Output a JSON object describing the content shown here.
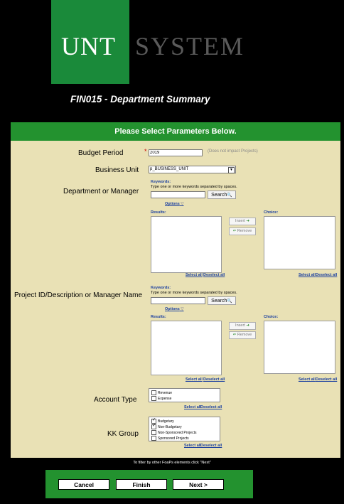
{
  "logo": {
    "word1": "UNT",
    "word2": "SYSTEM"
  },
  "page_title": "FIN015 - Department Summary",
  "panel_header": "Please Select Parameters Below.",
  "budget_period": {
    "label": "Budget Period",
    "required": "*",
    "value": "2019",
    "note": "(Does not impact Projects)"
  },
  "business_unit": {
    "label": "Business Unit",
    "value": "p_BUSINESS_UNIT"
  },
  "department": {
    "label": "Department or Manager",
    "keywords_label": "Keywords:",
    "keywords_hint": "Type one or more keywords separated by spaces.",
    "search_label": "Search",
    "options_label": "Options",
    "results_label": "Results:",
    "choice_label": "Choice:",
    "insert_label": "Insert",
    "remove_label": "Remove",
    "select_all": "Select all",
    "deselect_all": "Deselect all"
  },
  "project": {
    "label": "Project ID/Description or Manager Name",
    "keywords_label": "Keywords:",
    "keywords_hint": "Type one or more keywords separated by spaces.",
    "search_label": "Search",
    "options_label": "Options",
    "results_label": "Results:",
    "choice_label": "Choice:",
    "insert_label": "Insert",
    "remove_label": "Remove",
    "select_all": "Select all",
    "deselect_all": "Deselect all"
  },
  "account_type": {
    "label": "Account Type",
    "items": [
      {
        "label": "Revenue",
        "checked": false
      },
      {
        "label": "Expense",
        "checked": false
      }
    ],
    "select_all": "Select all",
    "deselect_all": "Deselect all"
  },
  "kk_group": {
    "label": "KK Group",
    "items": [
      {
        "label": "Budgetary",
        "checked": true
      },
      {
        "label": "Non-Budgetary",
        "checked": true
      },
      {
        "label": "Non-Sponsored Projects",
        "checked": false
      },
      {
        "label": "Sponsored Projects",
        "checked": false
      }
    ],
    "select_all": "Select all",
    "deselect_all": "Deselect all"
  },
  "footnote": "To filter by other FoaPs elements click \"Next\"",
  "buttons": {
    "cancel": "Cancel",
    "finish": "Finish",
    "next": "Next >"
  },
  "colors": {
    "green": "#23922f",
    "logo_green": "#1a8a3a",
    "panel": "#e9e1b5",
    "link": "#1a3fa0"
  }
}
